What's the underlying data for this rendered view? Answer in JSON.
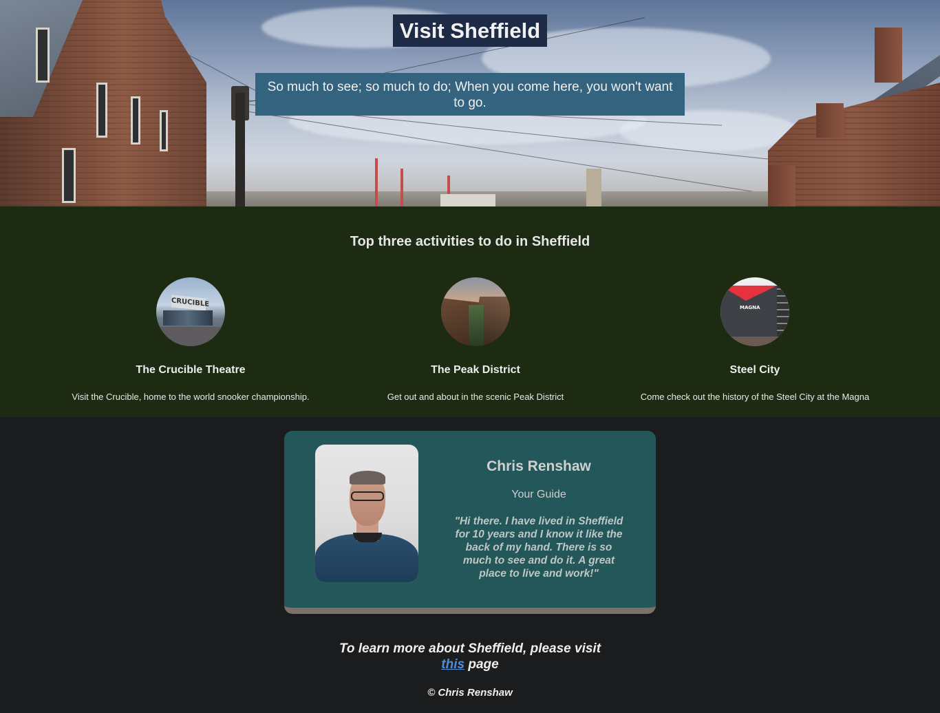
{
  "hero": {
    "title": "Visit Sheffield",
    "tagline": "So much to see; so much to do; When you come here, you won't want to go."
  },
  "activities": {
    "heading": "Top three activities to do in Sheffield",
    "items": [
      {
        "title": "The Crucible Theatre",
        "description": "Visit the Crucible, home to the world snooker championship.",
        "image": "crucible-theatre-photo",
        "sign_text": "CRUCIBLE"
      },
      {
        "title": "The Peak District",
        "description": "Get out and about in the scenic Peak District",
        "image": "peak-district-photo"
      },
      {
        "title": "Steel City",
        "description": "Come check out the history of the Steel City at the Magna",
        "image": "magna-photo",
        "sign_text": "MAGNA"
      }
    ]
  },
  "guide": {
    "name": "Chris Renshaw",
    "role": "Your Guide",
    "quote": "\"Hi there. I have lived in Sheffield for 10 years and I know it like the back of my hand. There is so much to see and do it. A great place to live and work!\"",
    "photo": "guide-portrait-photo"
  },
  "footer": {
    "text_before": "To learn more about Sheffield, please visit",
    "link_text": "this",
    "text_after": "page",
    "copyright": "© Chris Renshaw"
  },
  "colors": {
    "hero_title_bg": "#1e2b46",
    "hero_tagline_bg": "#34637f",
    "activities_bg": "#1c2b11",
    "page_bg": "#1b1c1e",
    "guide_card_bg": "#235759",
    "guide_card_border": "#7c7068",
    "link": "#4a90d9"
  }
}
